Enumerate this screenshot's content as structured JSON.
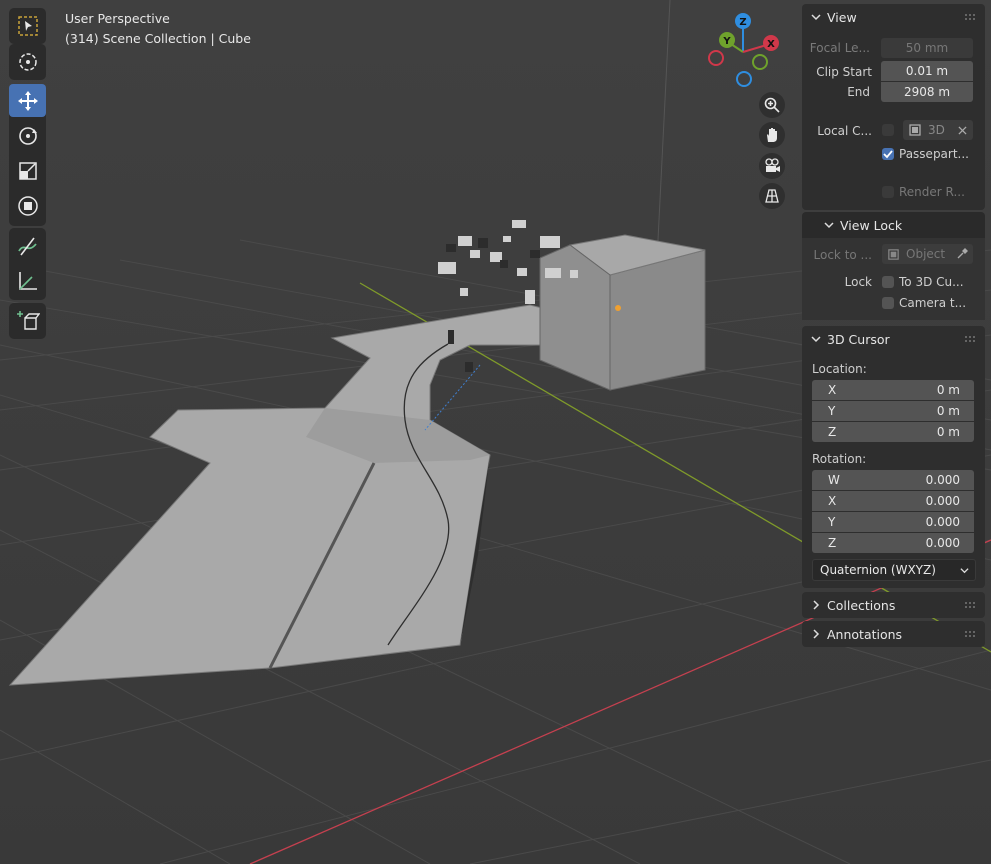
{
  "viewport": {
    "perspective_label": "User Perspective",
    "scene_label": "(314) Scene Collection | Cube",
    "gizmo": {
      "z": "Z",
      "y": "Y",
      "x": "X"
    },
    "toolbar": [
      {
        "name": "select-box-tool",
        "icon": "select-box-icon"
      },
      {
        "name": "cursor-tool",
        "icon": "cursor-icon"
      },
      {
        "name": "move-tool",
        "icon": "move-icon",
        "active": true
      },
      {
        "name": "rotate-tool",
        "icon": "rotate-icon"
      },
      {
        "name": "scale-tool",
        "icon": "scale-icon"
      },
      {
        "name": "transform-tool",
        "icon": "transform-icon"
      },
      {
        "name": "annotate-tool",
        "icon": "annotate-icon"
      },
      {
        "name": "measure-tool",
        "icon": "measure-icon"
      },
      {
        "name": "add-cube-tool",
        "icon": "add-cube-icon"
      }
    ],
    "nav_buttons": [
      "zoom-icon",
      "hand-pan-icon",
      "camera-icon",
      "grid-ortho-icon"
    ]
  },
  "sidebar": {
    "view": {
      "title": "View",
      "focal_label": "Focal Le...",
      "focal_value": "50 mm",
      "clip_start_label": "Clip Start",
      "clip_start_value": "0.01 m",
      "end_label": "End",
      "end_value": "2908 m",
      "local_camera_label": "Local C...",
      "local_camera_value": "3D",
      "passepartout_label": "Passepart...",
      "passepartout_checked": true,
      "render_region_label": "Render R..."
    },
    "view_lock": {
      "title": "View Lock",
      "lock_to_label": "Lock to ...",
      "lock_to_placeholder": "Object",
      "lock_label": "Lock",
      "to_3d_cursor_label": "To 3D Cu...",
      "camera_to_view_label": "Camera t..."
    },
    "cursor": {
      "title": "3D Cursor",
      "location_label": "Location:",
      "location": [
        {
          "axis": "X",
          "value": "0 m"
        },
        {
          "axis": "Y",
          "value": "0 m"
        },
        {
          "axis": "Z",
          "value": "0 m"
        }
      ],
      "rotation_label": "Rotation:",
      "rotation": [
        {
          "axis": "W",
          "value": "0.000"
        },
        {
          "axis": "X",
          "value": "0.000"
        },
        {
          "axis": "Y",
          "value": "0.000"
        },
        {
          "axis": "Z",
          "value": "0.000"
        }
      ],
      "rotation_mode": "Quaternion (WXYZ)"
    },
    "collections_title": "Collections",
    "annotations_title": "Annotations"
  },
  "colors": {
    "accent": "#4772b3",
    "axis_x": "#c5404f",
    "axis_y": "#7f9a2a",
    "gizmo_z": "#2f8ee0",
    "gizmo_y": "#6fa22c",
    "gizmo_x": "#d0384a"
  }
}
